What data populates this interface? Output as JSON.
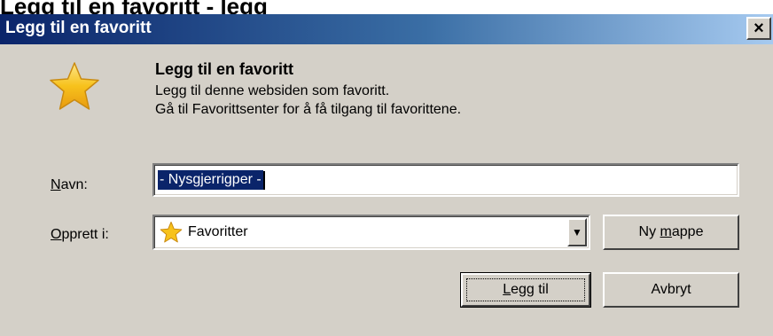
{
  "outer_title": "Legg til en favoritt - legg",
  "window": {
    "title": "Legg til en favoritt",
    "close_glyph": "×"
  },
  "content": {
    "heading": "Legg til en favoritt",
    "description_line1": "Legg til denne websiden som favoritt.",
    "description_line2": "Gå til Favorittsenter for å få tilgang til favorittene."
  },
  "form": {
    "name_label_mnemonic": "N",
    "name_label_rest": "avn:",
    "name_value": "- Nysgjerrigper -",
    "folder_label_mnemonic": "O",
    "folder_label_rest": "pprett i:",
    "folder_value": "Favoritter",
    "dropdown_glyph": "▼"
  },
  "buttons": {
    "new_folder_pre": "Ny ",
    "new_folder_mnemonic": "m",
    "new_folder_post": "appe",
    "add_mnemonic": "L",
    "add_rest": "egg til",
    "cancel": "Avbryt"
  },
  "icons": {
    "big_star": "star-icon",
    "folder_star": "favorites-star-icon"
  },
  "colors": {
    "titlebar_start": "#0a246a",
    "titlebar_end": "#a6caf0",
    "dialog_bg": "#d4d0c8",
    "selection": "#0a246a",
    "star": "#f7c21c"
  }
}
